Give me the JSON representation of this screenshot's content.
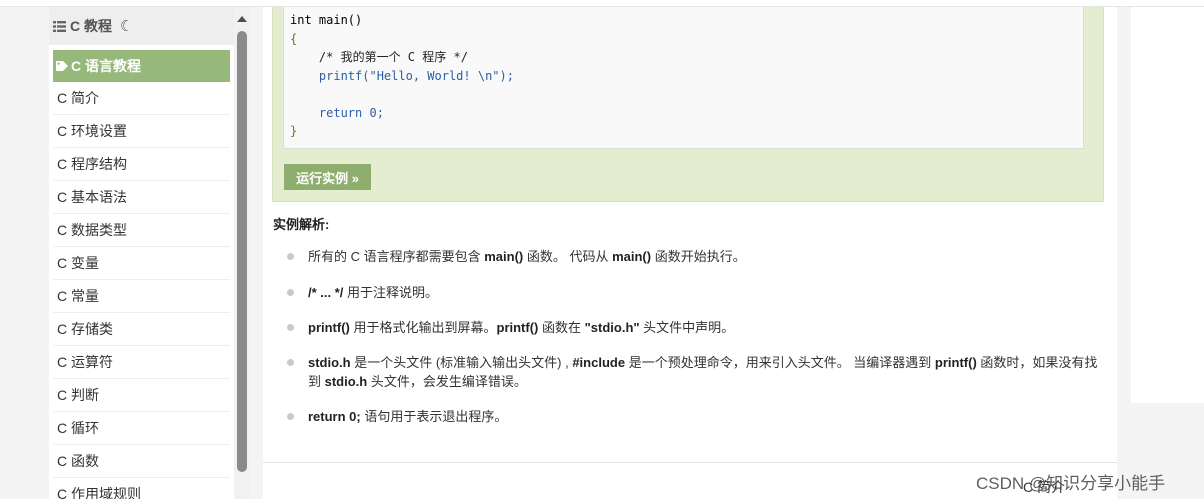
{
  "sidebar": {
    "header_title": "C 教程",
    "header_icon": "list-icon",
    "theme_icon": "moon-icon",
    "active_item": "C 语言教程",
    "items": [
      "C 简介",
      "C 环境设置",
      "C 程序结构",
      "C 基本语法",
      "C 数据类型",
      "C 变量",
      "C 常量",
      "C 存储类",
      "C 运算符",
      "C 判断",
      "C 循环",
      "C 函数",
      "C 作用域规则"
    ]
  },
  "code": {
    "lines": [
      "int main()",
      "{",
      "    /* 我的第一个 C 程序 */",
      "    printf(\"Hello, World! \\n\");",
      "",
      "    return 0;",
      "}"
    ]
  },
  "run_button": "运行实例 »",
  "analysis": {
    "title": "实例解析:",
    "b1": {
      "t1": "所有的 C 语言程序都需要包含 ",
      "b1": "main()",
      "t2": " 函数。 代码从 ",
      "b2": "main()",
      "t3": " 函数开始执行。"
    },
    "b2": {
      "b1": "/* ... */",
      "t1": " 用于注释说明。"
    },
    "b3": {
      "b1": "printf()",
      "t1": " 用于格式化输出到屏幕。",
      "b2": "printf()",
      "t2": " 函数在 ",
      "b3": "\"stdio.h\"",
      "t3": " 头文件中声明。"
    },
    "b4": {
      "b1": "stdio.h",
      "t1": " 是一个头文件 (标准输入输出头文件) , ",
      "b2": "#include",
      "t2": " 是一个预处理命令，用来引入头文件。 当编译器遇到 ",
      "b3": "printf()",
      "t3": " 函数时，如果没有找到 ",
      "b4": "stdio.h",
      "t4": " 头文件，会发生编译错误。"
    },
    "b5": {
      "b1": "return 0;",
      "t1": " 语句用于表示退出程序。"
    }
  },
  "next_link": "C 简介",
  "watermark": "CSDN @知识分享小能手",
  "colors": {
    "accent": "#96b97b",
    "example_bg": "#e4edcf",
    "button": "#8eae6d"
  }
}
